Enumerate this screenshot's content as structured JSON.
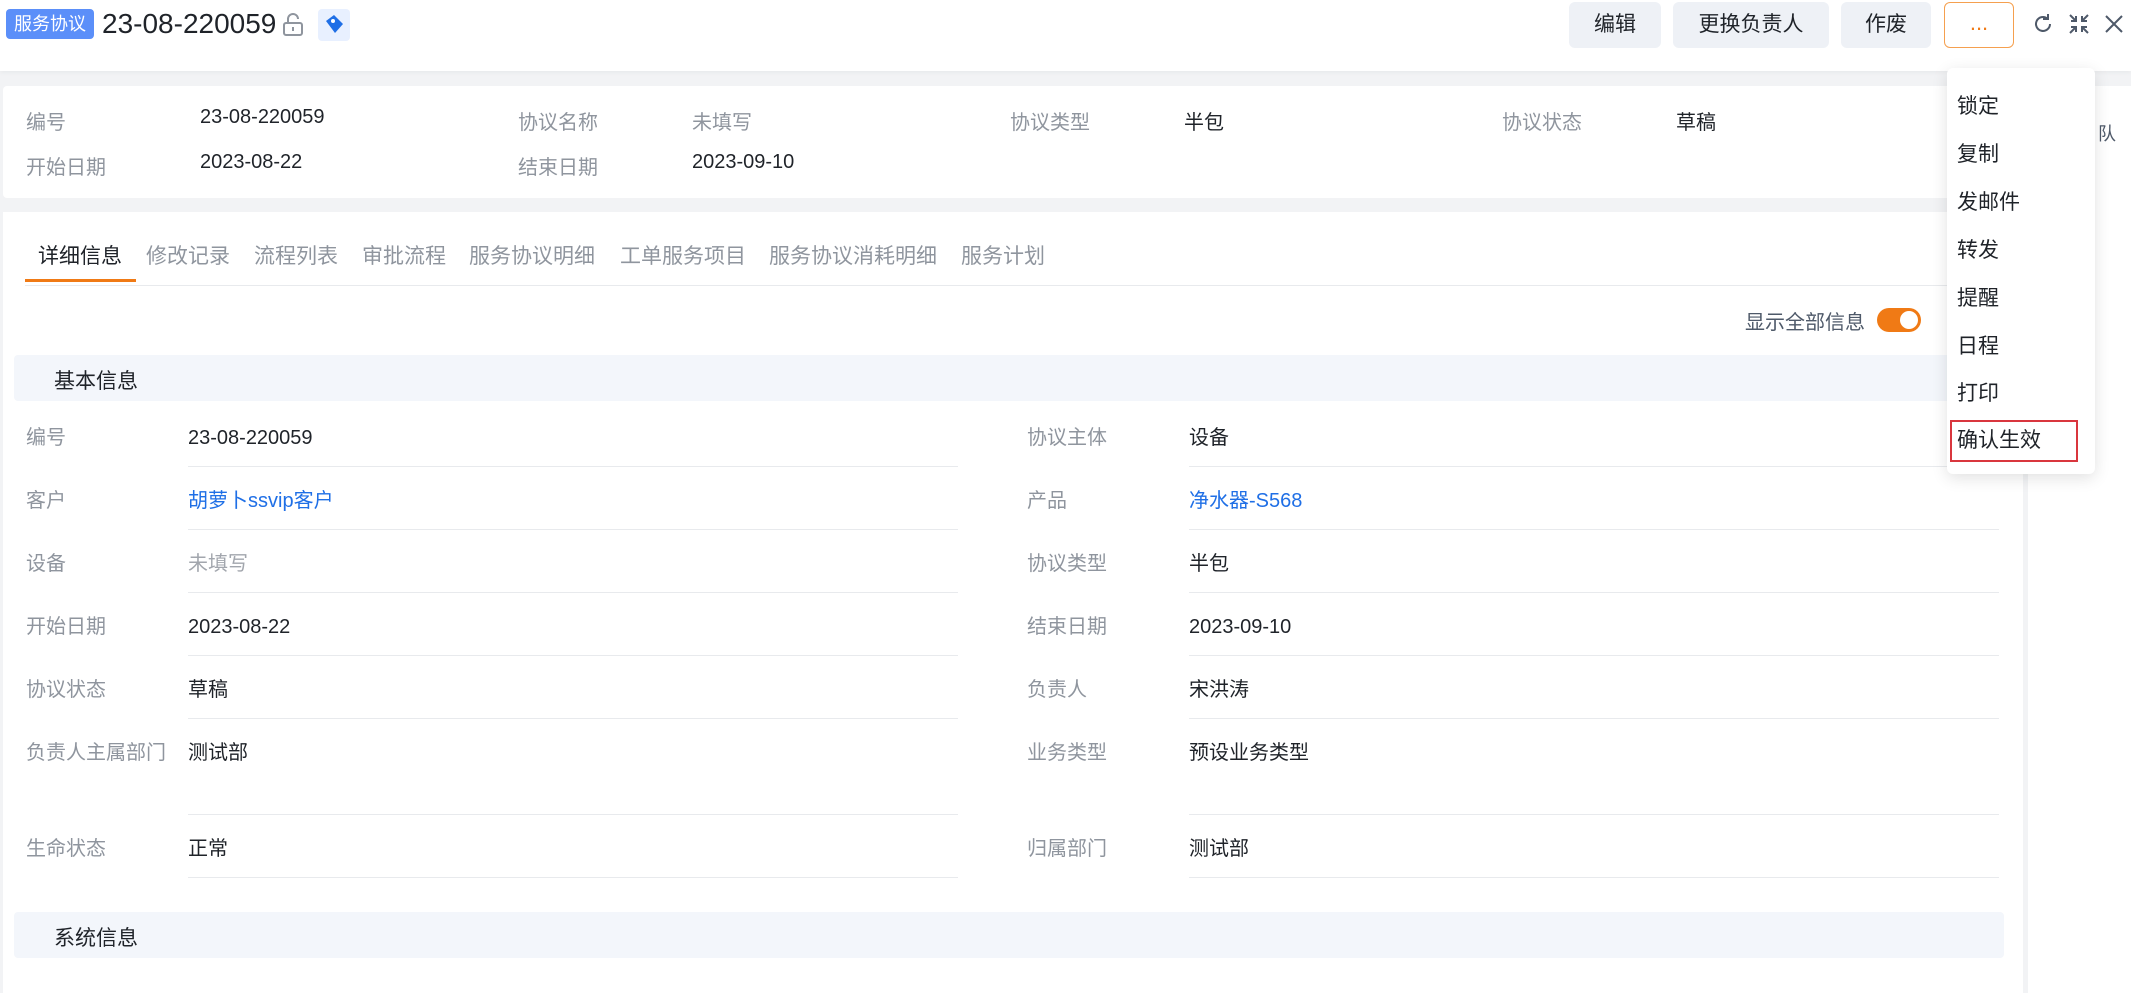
{
  "header": {
    "tag": "服务协议",
    "title": "23-08-220059",
    "buttons": {
      "edit": "编辑",
      "change_owner": "更换负责人",
      "void": "作废",
      "more": "..."
    }
  },
  "summary": {
    "fields": [
      {
        "label": "编号",
        "value": "23-08-220059"
      },
      {
        "label": "协议名称",
        "value": "未填写"
      },
      {
        "label": "协议类型",
        "value": "半包"
      },
      {
        "label": "协议状态",
        "value": "草稿"
      },
      {
        "label": "开始日期",
        "value": "2023-08-22"
      },
      {
        "label": "结束日期",
        "value": "2023-09-10"
      }
    ]
  },
  "tabs": [
    "详细信息",
    "修改记录",
    "流程列表",
    "审批流程",
    "服务协议明细",
    "工单服务项目",
    "服务协议消耗明细",
    "服务计划"
  ],
  "toggle": {
    "label": "显示全部信息",
    "on": true
  },
  "sections": {
    "basic": "基本信息",
    "system": "系统信息"
  },
  "fields": {
    "left": [
      {
        "label": "编号",
        "value": "23-08-220059"
      },
      {
        "label": "客户",
        "value": "胡萝卜ssvip客户"
      },
      {
        "label": "设备",
        "value": "未填写"
      },
      {
        "label": "开始日期",
        "value": "2023-08-22"
      },
      {
        "label": "协议状态",
        "value": "草稿"
      },
      {
        "label": "负责人主属部门",
        "value": "测试部"
      },
      {
        "label": "生命状态",
        "value": "正常"
      }
    ],
    "right": [
      {
        "label": "协议主体",
        "value": "设备"
      },
      {
        "label": "产品",
        "value": "净水器-S568"
      },
      {
        "label": "协议类型",
        "value": "半包"
      },
      {
        "label": "结束日期",
        "value": "2023-09-10"
      },
      {
        "label": "负责人",
        "value": "宋洪涛"
      },
      {
        "label": "业务类型",
        "value": "预设业务类型"
      },
      {
        "label": "归属部门",
        "value": "测试部"
      }
    ]
  },
  "side_panel": {
    "text": "队"
  },
  "dropdown": {
    "items": [
      "锁定",
      "复制",
      "发邮件",
      "转发",
      "提醒",
      "日程",
      "打印",
      "确认生效"
    ]
  },
  "colors": {
    "accent": "#f07a15",
    "link": "#1f6fe6",
    "tag": "#5b8ff9",
    "highlight": "#d9363e"
  }
}
